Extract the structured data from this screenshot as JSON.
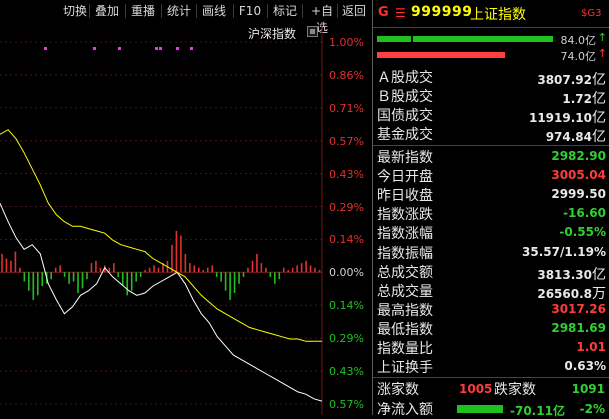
{
  "toolbar": {
    "buttons": [
      "切换",
      "叠加",
      "重播",
      "统计",
      "画线",
      "F10",
      "标记",
      "+自选",
      "返回"
    ]
  },
  "chart": {
    "index_label": "沪深指数",
    "pct_labels": [
      "1.00%",
      "0.86%",
      "0.71%",
      "0.57%",
      "0.43%",
      "0.29%",
      "0.14%",
      "0.00%",
      "0.14%",
      "0.29%",
      "0.43%",
      "0.57%"
    ],
    "colors": {
      "up": "#e03030",
      "down": "#20c020",
      "price_line": "#ffffff",
      "avg_line": "#ffff00",
      "marker": "#e040e0"
    }
  },
  "chart_data": {
    "type": "line",
    "ylim": [
      -0.57,
      1.0
    ],
    "series": [
      {
        "values": [
          0.3,
          0.22,
          0.15,
          0.1,
          0.12,
          0.08,
          -0.05,
          -0.12,
          -0.18,
          -0.15,
          -0.1,
          -0.08,
          -0.05,
          0.02,
          -0.02,
          -0.05,
          -0.08,
          -0.1,
          -0.09,
          -0.06,
          -0.04,
          -0.02,
          0.0,
          -0.05,
          -0.12,
          -0.18,
          -0.22,
          -0.28,
          -0.32,
          -0.36,
          -0.38,
          -0.4,
          -0.42,
          -0.44,
          -0.46,
          -0.48,
          -0.5,
          -0.52,
          -0.53,
          -0.55,
          -0.56
        ]
      },
      {
        "values": [
          0.6,
          0.62,
          0.58,
          0.52,
          0.45,
          0.38,
          0.3,
          0.25,
          0.22,
          0.2,
          0.2,
          0.19,
          0.18,
          0.17,
          0.14,
          0.12,
          0.11,
          0.1,
          0.09,
          0.06,
          0.04,
          0.02,
          0.0,
          -0.02,
          -0.06,
          -0.1,
          -0.13,
          -0.16,
          -0.18,
          -0.2,
          -0.22,
          -0.24,
          -0.25,
          -0.26,
          -0.27,
          -0.28,
          -0.29,
          -0.29,
          -0.3,
          -0.3,
          -0.3
        ]
      }
    ],
    "volume_bars": [
      0.08,
      0.06,
      0.05,
      0.09,
      0.02,
      -0.04,
      -0.08,
      -0.12,
      -0.1,
      -0.06,
      -0.05,
      -0.03,
      0.02,
      0.03,
      -0.02,
      -0.05,
      -0.04,
      -0.09,
      -0.07,
      -0.03,
      0.04,
      0.05,
      0.02,
      0.03,
      0.02,
      0.04,
      -0.02,
      -0.06,
      -0.1,
      -0.08,
      -0.04,
      -0.02,
      0.01,
      0.02,
      0.03,
      0.02,
      0.04,
      0.05,
      0.12,
      0.18,
      0.16,
      0.08,
      0.04,
      0.03,
      0.02,
      0.01,
      0.02,
      0.03,
      -0.02,
      -0.04,
      -0.08,
      -0.12,
      -0.09,
      -0.05,
      -0.02,
      0.02,
      0.05,
      0.08,
      0.04,
      0.02,
      -0.02,
      -0.05,
      -0.03,
      0.02,
      0.01,
      0.02,
      0.03,
      0.04,
      0.05,
      0.03,
      0.02,
      0.01
    ]
  },
  "header": {
    "g": "G",
    "menu": "☰",
    "code": "999999",
    "name": "上证指数",
    "tag": "$G3"
  },
  "bars": [
    {
      "value": "84.0亿",
      "arrow": "↑",
      "arrow_color": "#30d030",
      "bar_color": "green",
      "fill": 0.95
    },
    {
      "value": "74.0亿",
      "arrow": "↑",
      "arrow_color": "#ff3c3c",
      "bar_color": "red",
      "fill": 0.84
    }
  ],
  "turnover": [
    {
      "label": "Ａ股成交",
      "value": "3807.92",
      "unit": "亿"
    },
    {
      "label": "Ｂ股成交",
      "value": "1.72",
      "unit": "亿"
    },
    {
      "label": "国债成交",
      "value": "11919.10",
      "unit": "亿"
    },
    {
      "label": "基金成交",
      "value": "974.84",
      "unit": "亿"
    }
  ],
  "stats": [
    {
      "label": "最新指数",
      "value": "2982.90",
      "color": "g"
    },
    {
      "label": "今日开盘",
      "value": "3005.04",
      "color": "r"
    },
    {
      "label": "昨日收盘",
      "value": "2999.50",
      "color": "w"
    },
    {
      "label": "指数涨跌",
      "value": "-16.60",
      "color": "g"
    },
    {
      "label": "指数涨幅",
      "value": "-0.55%",
      "color": "g"
    },
    {
      "label": "指数振幅",
      "value": "35.57/1.19%",
      "color": "w"
    },
    {
      "label": "总成交额",
      "value": "3813.30",
      "unit": "亿",
      "color": "w"
    },
    {
      "label": "总成交量",
      "value": "26560.8",
      "unit": "万",
      "color": "w"
    },
    {
      "label": "最高指数",
      "value": "3017.26",
      "color": "r"
    },
    {
      "label": "最低指数",
      "value": "2981.69",
      "color": "g"
    },
    {
      "label": "指数量比",
      "value": "1.01",
      "color": "r"
    },
    {
      "label": "上证换手",
      "value": "0.63%",
      "color": "w"
    }
  ],
  "breadth": {
    "up_label": "涨家数",
    "up_value": "1005",
    "down_label": "跌家数",
    "down_value": "1091"
  },
  "inflow": {
    "label": "净流入额",
    "value": "-70.11亿",
    "pct": "-2%"
  }
}
